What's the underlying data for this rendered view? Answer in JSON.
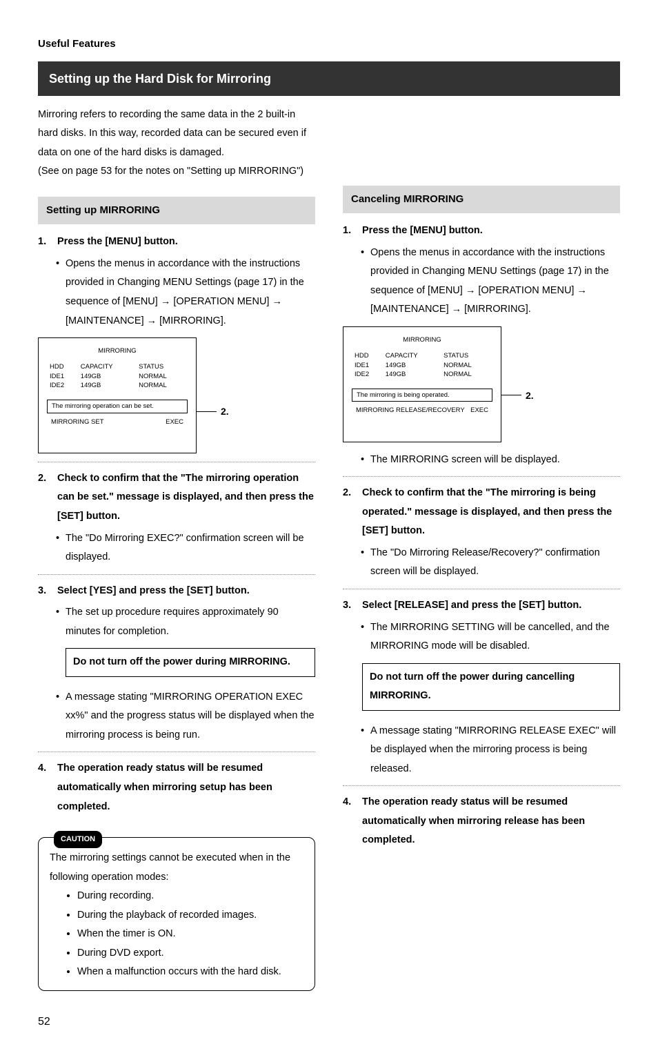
{
  "labels": {
    "section": "Useful Features",
    "title": "Setting up the Hard Disk for Mirroring",
    "caution": "CAUTION",
    "page_num": "52"
  },
  "intro": {
    "p1": "Mirroring refers to recording the same data in the 2 built-in hard disks. In this way, recorded data can be secured even if data on one of the hard disks is damaged.",
    "p2": "(See on page 53 for the notes on \"Setting up MIRRORING\")"
  },
  "left": {
    "header": "Setting up MIRRORING",
    "step1_num": "1.",
    "step1_text": "Press the [MENU] button.",
    "step1_b1": "Opens the menus in accordance with the instructions provided in Changing MENU Settings (page 17) in the sequence of [MENU] → [OPERATION MENU] → [MAINTENANCE] → [MIRRORING].",
    "screen": {
      "title": "MIRRORING",
      "h_hdd": "HDD",
      "h_cap": "CAPACITY",
      "h_stat": "STATUS",
      "r1_a": "IDE1",
      "r1_b": "149GB",
      "r1_c": "NORMAL",
      "r2_a": "IDE2",
      "r2_b": "149GB",
      "r2_c": "NORMAL",
      "msg": "The mirroring operation can be set.",
      "exec_l": "MIRRORING SET",
      "exec_r": "EXEC",
      "annot": "2."
    },
    "step2_num": "2.",
    "step2_text": "Check to confirm that the \"The mirroring operation can be set.\" message is displayed, and then press the [SET] button.",
    "step2_b1": "The \"Do Mirroring EXEC?\" confirmation screen will be displayed.",
    "step3_num": "3.",
    "step3_text": "Select [YES] and press the [SET] button.",
    "step3_b1": "The set up procedure requires approximately 90 minutes for completion.",
    "note": "Do not turn off the power during MIRRORING.",
    "step3_b2": "A message stating \"MIRRORING OPERATION EXEC xx%\" and the progress status will be displayed when the mirroring process is being run.",
    "step4_num": "4.",
    "step4_text": "The operation ready status will be resumed automatically when mirroring setup has been completed.",
    "caution_intro": "The mirroring settings cannot be executed when in the following operation modes:",
    "caution_items": {
      "c1": "During recording.",
      "c2": "During the playback of recorded images.",
      "c3": "When the timer is ON.",
      "c4": "During DVD export.",
      "c5": "When a malfunction occurs with the hard disk."
    }
  },
  "right": {
    "header": "Canceling MIRRORING",
    "step1_num": "1.",
    "step1_text": "Press the [MENU] button.",
    "step1_b1": "Opens the menus in accordance with the instructions provided in Changing MENU Settings (page 17) in the sequence of [MENU] → [OPERATION MENU] → [MAINTENANCE] → [MIRRORING].",
    "screen": {
      "title": "MIRRORING",
      "h_hdd": "HDD",
      "h_cap": "CAPACITY",
      "h_stat": "STATUS",
      "r1_a": "IDE1",
      "r1_b": "149GB",
      "r1_c": "NORMAL",
      "r2_a": "IDE2",
      "r2_b": "149GB",
      "r2_c": "NORMAL",
      "msg": "The mirroring is being operated.",
      "exec_l": "MIRRORING RELEASE/RECOVERY",
      "exec_r": "EXEC",
      "annot": "2."
    },
    "step1_b2": "The MIRRORING screen will be displayed.",
    "step2_num": "2.",
    "step2_text": "Check to confirm that the \"The mirroring is being operated.\" message is displayed, and then press the [SET] button.",
    "step2_b1": "The \"Do Mirroring Release/Recovery?\" confirmation screen will be displayed.",
    "step3_num": "3.",
    "step3_text": "Select [RELEASE] and press the [SET] button.",
    "step3_b1": "The MIRRORING SETTING will be cancelled, and the MIRRORING mode will be disabled.",
    "note": "Do not turn off the power during cancelling MIRRORING.",
    "step3_b2": "A message stating \"MIRRORING RELEASE EXEC\" will be displayed when the mirroring process is being released.",
    "step4_num": "4.",
    "step4_text": "The operation ready status will be resumed automatically when mirroring release has been completed."
  }
}
